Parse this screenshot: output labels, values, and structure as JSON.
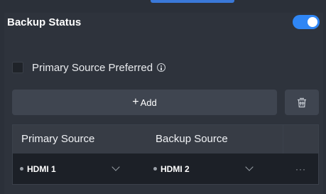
{
  "header": {
    "title": "Backup Status",
    "toggle_on": true
  },
  "options": {
    "primary_preferred_label": "Primary Source Preferred",
    "primary_preferred_checked": false
  },
  "actions": {
    "add_plus": "+",
    "add_label": "Add"
  },
  "table": {
    "columns": [
      "Primary Source",
      "Backup Source"
    ],
    "rows": [
      {
        "primary": "HDMI 1",
        "backup": "HDMI 2",
        "more": "···"
      }
    ]
  },
  "colors": {
    "accent": "#2f86f5",
    "panel_bg": "#2e333c",
    "row_bg": "#1c2027"
  },
  "icons": {
    "info": "info-icon",
    "delete": "trash-icon",
    "dropdown": "chevron-down-icon",
    "more": "ellipsis-icon"
  }
}
